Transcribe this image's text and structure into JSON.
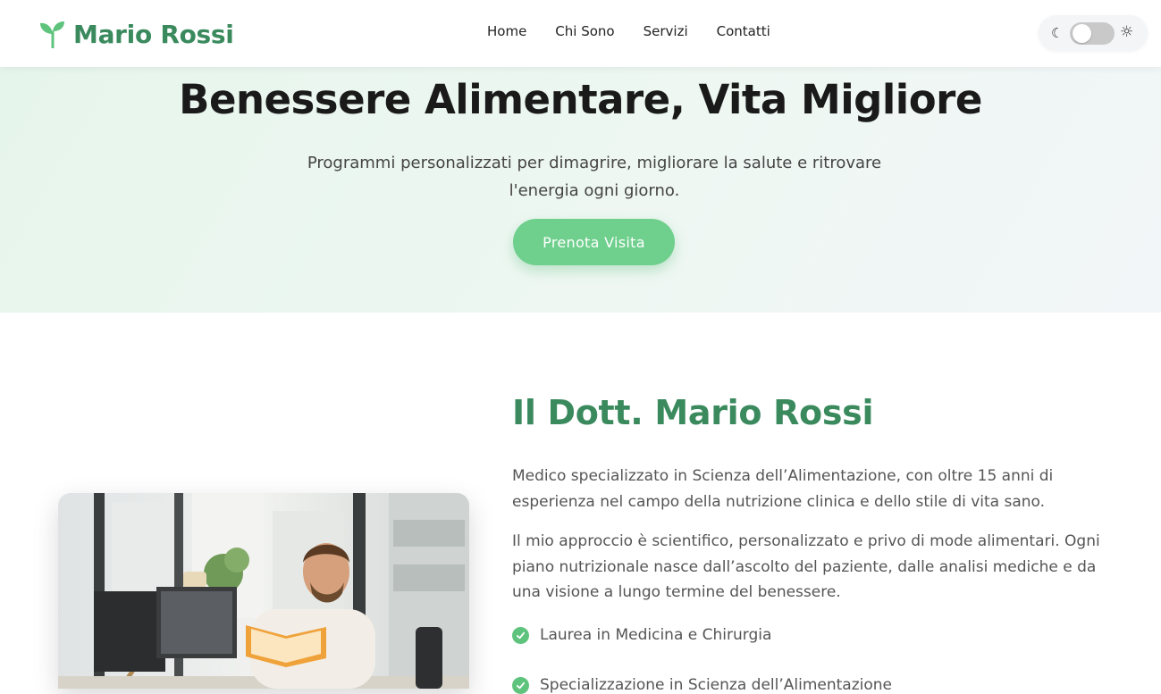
{
  "header": {
    "logo_text": "Mario Rossi",
    "nav": [
      "Home",
      "Chi Sono",
      "Servizi",
      "Contatti"
    ],
    "theme_toggle": {
      "left_icon": "moon-icon",
      "right_icon": "sun-icon",
      "state": "light"
    }
  },
  "hero": {
    "title": "Benessere Alimentare, Vita Migliore",
    "subtitle": "Programmi personalizzati per dimagrire, migliorare la salute e ritrovare l'energia ogni giorno.",
    "cta": "Prenota Visita"
  },
  "about": {
    "title": "Il Dott. Mario Rossi",
    "paragraphs": [
      "Medico specializzato in Scienza dell’Alimentazione, con oltre 15 anni di esperienza nel campo della nutrizione clinica e dello stile di vita sano.",
      "Il mio approccio è scientifico, personalizzato e privo di mode alimentari. Ogni piano nutrizionale nasce dall’ascolto del paziente, dalle analisi mediche e da una visione a lungo termine del benessere."
    ],
    "credentials": [
      "Laurea in Medicina e Chirurgia",
      "Specializzazione in Scienza dell’Alimentazione"
    ]
  },
  "colors": {
    "brand": "#3a8a5e",
    "accent": "#6fcf8d",
    "check": "#5ec37d"
  }
}
